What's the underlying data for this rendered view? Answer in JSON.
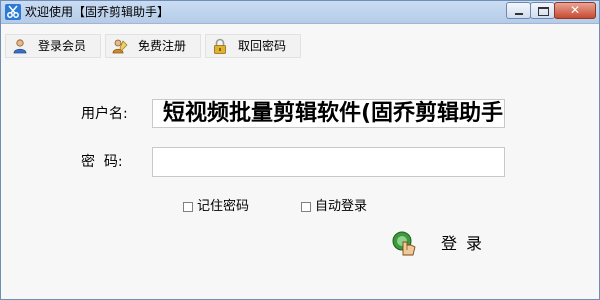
{
  "window": {
    "title": "欢迎使用【固乔剪辑助手】"
  },
  "toolbar": {
    "items": [
      {
        "label": "登录会员",
        "icon": "user-icon"
      },
      {
        "label": "免费注册",
        "icon": "register-icon"
      },
      {
        "label": "取回密码",
        "icon": "lock-icon"
      }
    ]
  },
  "form": {
    "username_label": "用户名:",
    "username_value": "短视频批量剪辑软件(固乔剪辑助手)",
    "password_label": "密  码:",
    "password_value": "",
    "remember_label": "记住密码",
    "remember_checked": false,
    "auto_login_label": "自动登录",
    "auto_login_checked": false
  },
  "login": {
    "label": "登录",
    "icon": "hand-pointer-icon"
  },
  "colors": {
    "titlebar": "#c9dcf3",
    "close_button": "#c74a32",
    "background": "#f7f7f7"
  }
}
